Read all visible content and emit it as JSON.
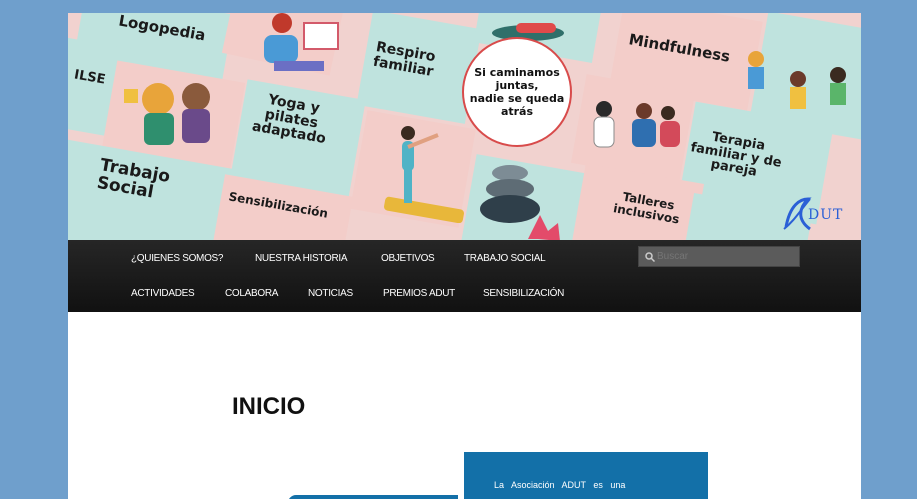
{
  "banner": {
    "logopedia": "Logopedia",
    "ilse": "ILSE",
    "respiro_line1": "Respiro",
    "respiro_line2": "familiar",
    "circle_line1": "Si caminamos",
    "circle_line2": "juntas,",
    "circle_line3": "nadie se queda",
    "circle_line4": "atrás",
    "mindfulness": "Mindfulness",
    "yoga_line1": "Yoga y",
    "yoga_line2": "pilates",
    "yoga_line3": "adaptado",
    "terapia_line1": "Terapia",
    "terapia_line2": "familiar y de",
    "terapia_line3": "pareja",
    "trabajo_line1": "Trabajo",
    "trabajo_line2": "Social",
    "sensibilizacion": "Sensibilización",
    "talleres_line1": "Talleres",
    "talleres_line2": "inclusivos",
    "logo_text": "DUT"
  },
  "nav": {
    "row1": [
      "¿QUIENES SOMOS?",
      "NUESTRA HISTORIA",
      "OBJETIVOS",
      "TRABAJO SOCIAL"
    ],
    "row2": [
      "ACTIVIDADES",
      "COLABORA",
      "NOTICIAS",
      "PREMIOS ADUT",
      "SENSIBILIZACIÓN"
    ],
    "search_placeholder": "Buscar"
  },
  "main": {
    "title": "INICIO",
    "info_text": "La Asociación ADUT es una"
  },
  "colors": {
    "background": "#6f9fcc",
    "nav_bg": "#1c1c1c",
    "teal_tile": "#bfe3de",
    "pink_tile": "#f3cdc9",
    "info_box": "#1370a8",
    "logo_blue": "#2b5fd6"
  }
}
